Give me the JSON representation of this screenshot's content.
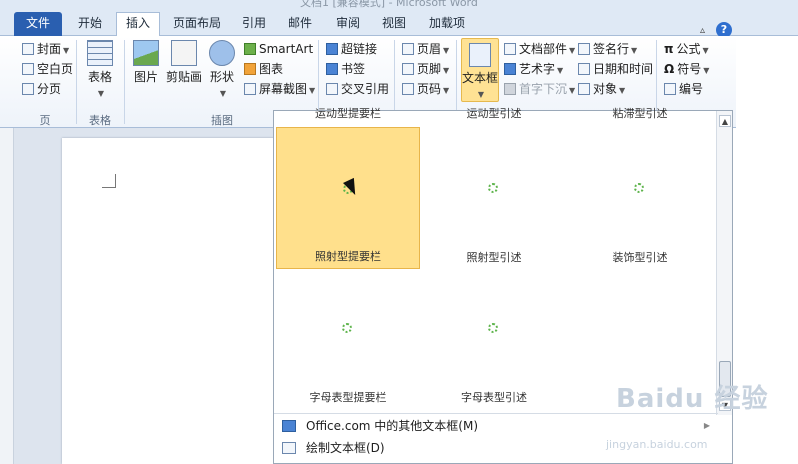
{
  "window": {
    "title_partial": "文档1 [兼容模式] - Microsoft Word"
  },
  "tabs": [
    "文件",
    "开始",
    "插入",
    "页面布局",
    "引用",
    "邮件",
    "审阅",
    "视图",
    "加载项"
  ],
  "active_tab": "插入",
  "ribbon": {
    "pages": {
      "cover": "封面",
      "blank": "空白页",
      "break": "分页",
      "label": "页"
    },
    "tables": {
      "table": "表格",
      "label": "表格"
    },
    "illustrations": {
      "picture": "图片",
      "clipart": "剪贴画",
      "shapes": "形状",
      "smartart": "SmartArt",
      "chart": "图表",
      "screenshot": "屏幕截图",
      "label": "插图"
    },
    "links": {
      "hyperlink": "超链接",
      "bookmark": "书签",
      "crossref": "交叉引用"
    },
    "header_footer": {
      "header": "页眉",
      "footer": "页脚",
      "page_number": "页码"
    },
    "text": {
      "textbox": "文本框",
      "quickparts": "文档部件",
      "wordart": "艺术字",
      "dropcap": "首字下沉",
      "signature": "签名行",
      "datetime": "日期和时间",
      "object": "对象"
    },
    "symbols": {
      "equation": "公式",
      "symbol": "符号",
      "number": "编号"
    }
  },
  "gallery": {
    "top_labels": [
      "运动型提要栏",
      "运动型引述",
      "粘滞型引述"
    ],
    "items": [
      {
        "label": "照射型提要栏"
      },
      {
        "label": "照射型引述"
      },
      {
        "label": "装饰型引述"
      },
      {
        "label": "字母表型提要栏"
      },
      {
        "label": "字母表型引述"
      }
    ],
    "menu": [
      {
        "label": "Office.com 中的其他文本框(M)"
      },
      {
        "label": "绘制文本框(D)"
      }
    ]
  },
  "watermark": {
    "brand": "Baidu 经验",
    "url": "jingyan.baidu.com"
  },
  "colors": {
    "accent": "#2a5fb0",
    "hover": "#ffe08c",
    "spinner": "#5cb34a"
  }
}
